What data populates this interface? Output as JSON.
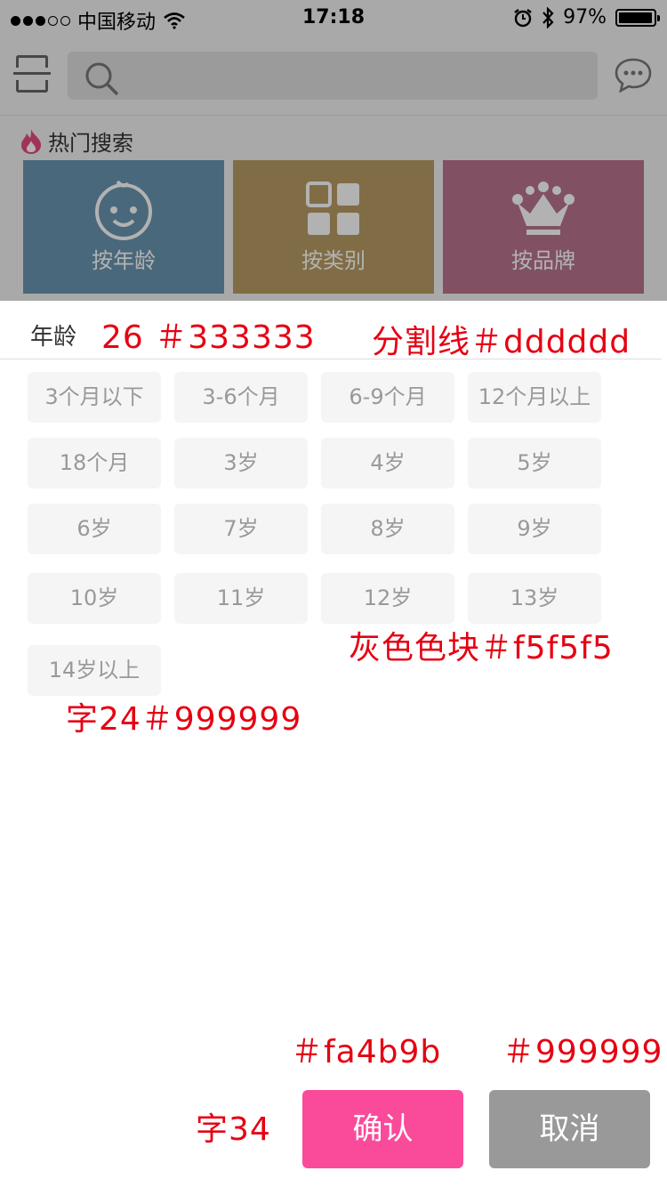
{
  "status_bar": {
    "carrier": "中国移动",
    "time": "17:18",
    "battery_text": "97%",
    "battery_level": 0.97
  },
  "hot_search": {
    "title": "热门搜索",
    "tiles": [
      {
        "label": "按年龄",
        "color": "#6a95b0",
        "icon": "baby-face-icon"
      },
      {
        "label": "按类别",
        "color": "#b99c63",
        "icon": "category-grid-icon"
      },
      {
        "label": "按品牌",
        "color": "#b9738f",
        "icon": "crown-icon"
      }
    ]
  },
  "panel": {
    "title": "年龄",
    "options": [
      "3个月以下",
      "3-6个月",
      "6-9个月",
      "12个月以上",
      "18个月",
      "3岁",
      "4岁",
      "5岁",
      "6岁",
      "7岁",
      "8岁",
      "9岁",
      "10岁",
      "11岁",
      "12岁",
      "13岁",
      "14岁以上"
    ],
    "confirm_label": "确认",
    "cancel_label": "取消"
  },
  "colors": {
    "title_text": "#333333",
    "divider": "#dddddd",
    "chip_bg": "#f5f5f5",
    "chip_text": "#999999",
    "confirm_bg": "#fa4b9b",
    "cancel_bg": "#999999",
    "annotation": "#e60012"
  },
  "annotations": {
    "title_spec": "26 ＃333333",
    "divider_spec": "分割线＃dddddd",
    "chip_spec": "灰色色块＃f5f5f5",
    "chip_text_spec": "字24＃999999",
    "confirm_color_spec": "＃fa4b9b",
    "cancel_color_spec": "＃999999",
    "button_text_spec": "字34"
  }
}
